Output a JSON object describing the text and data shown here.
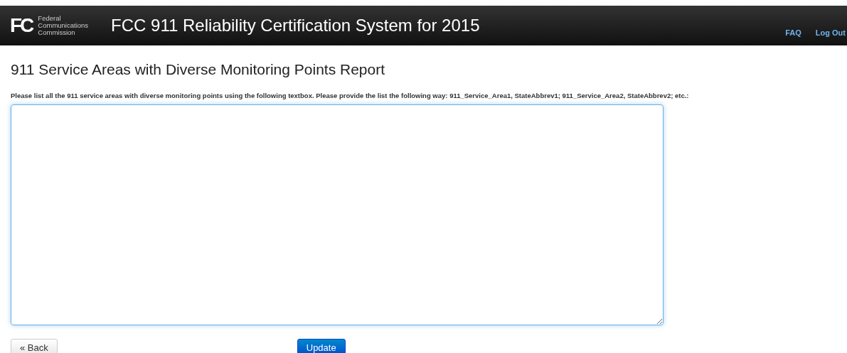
{
  "header": {
    "logo_mark": "FC",
    "logo_lines": [
      "Federal",
      "Communications",
      "Commission"
    ],
    "title": "FCC 911 Reliability Certification System for 2015",
    "links": [
      "FAQ",
      "Log Out"
    ]
  },
  "page_title": "911 Service Areas with Diverse Monitoring Points Report",
  "instruction": "Please list all the 911 service areas with diverse monitoring points using the following textbox. Please provide the list the following way: 911_Service_Area1, StateAbbrev1; 911_Service_Area2, StateAbbrev2; etc.:",
  "buttons": [
    {
      "label": "« Back",
      "kind": "secondary"
    },
    {
      "label": "Update",
      "kind": "primary"
    }
  ]
}
